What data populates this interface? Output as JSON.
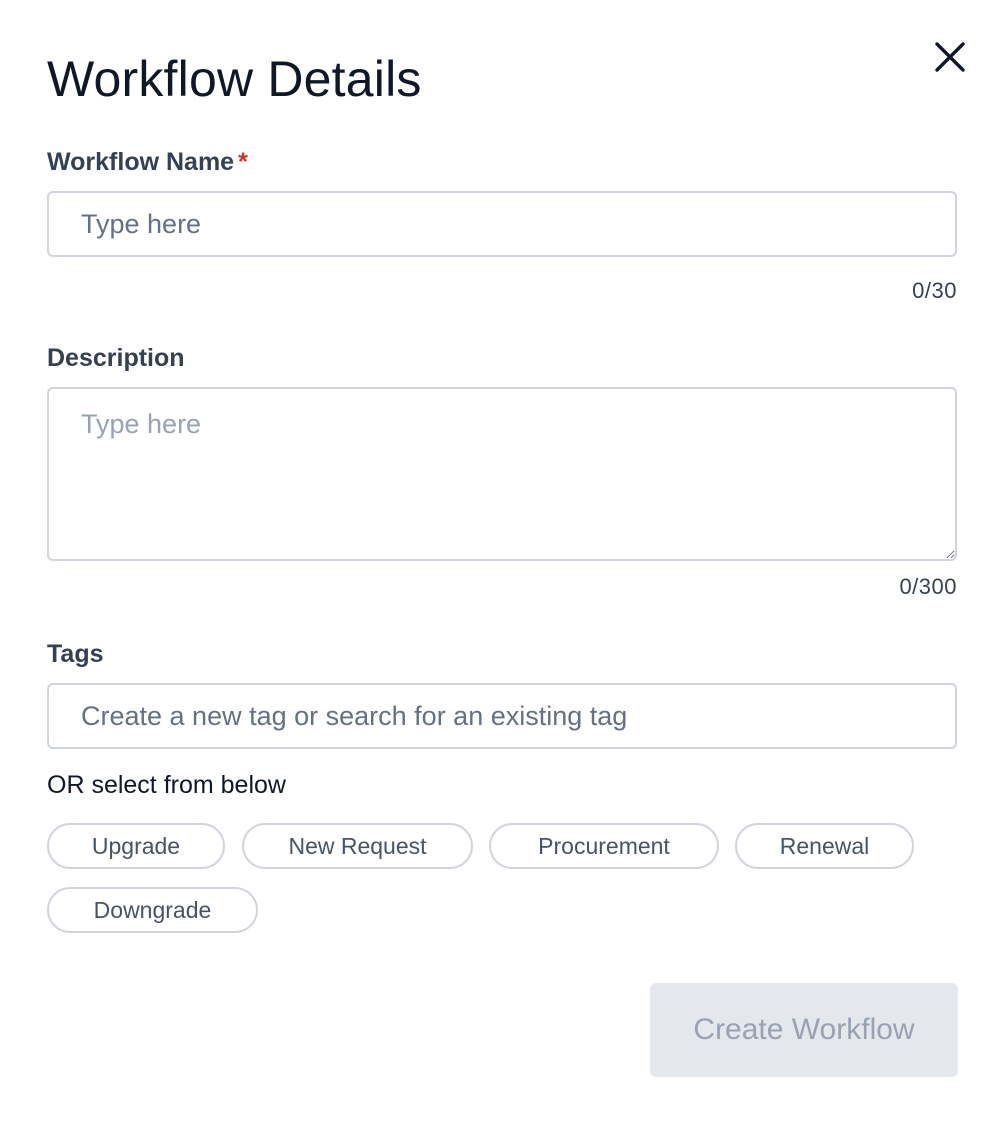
{
  "dialog": {
    "title": "Workflow Details",
    "close_icon": "close-icon"
  },
  "workflow_name": {
    "label": "Workflow Name",
    "required_marker": "*",
    "value": "",
    "placeholder": "Type here",
    "counter": "0/30"
  },
  "description": {
    "label": "Description",
    "value": "",
    "placeholder": "Type here",
    "counter": "0/300"
  },
  "tags": {
    "label": "Tags",
    "search_value": "",
    "search_placeholder": "Create a new tag or search for an existing tag",
    "or_text": "OR select from below",
    "options": [
      "Upgrade",
      "New Request",
      "Procurement",
      "Renewal",
      "Downgrade"
    ]
  },
  "footer": {
    "create_label": "Create Workflow",
    "create_enabled": false
  },
  "colors": {
    "title": "#101828",
    "label": "#344054",
    "required": "#d92d20",
    "border": "#d0d5dd",
    "disabled_bg": "#e4e7ec",
    "disabled_text": "#98a2b3"
  }
}
